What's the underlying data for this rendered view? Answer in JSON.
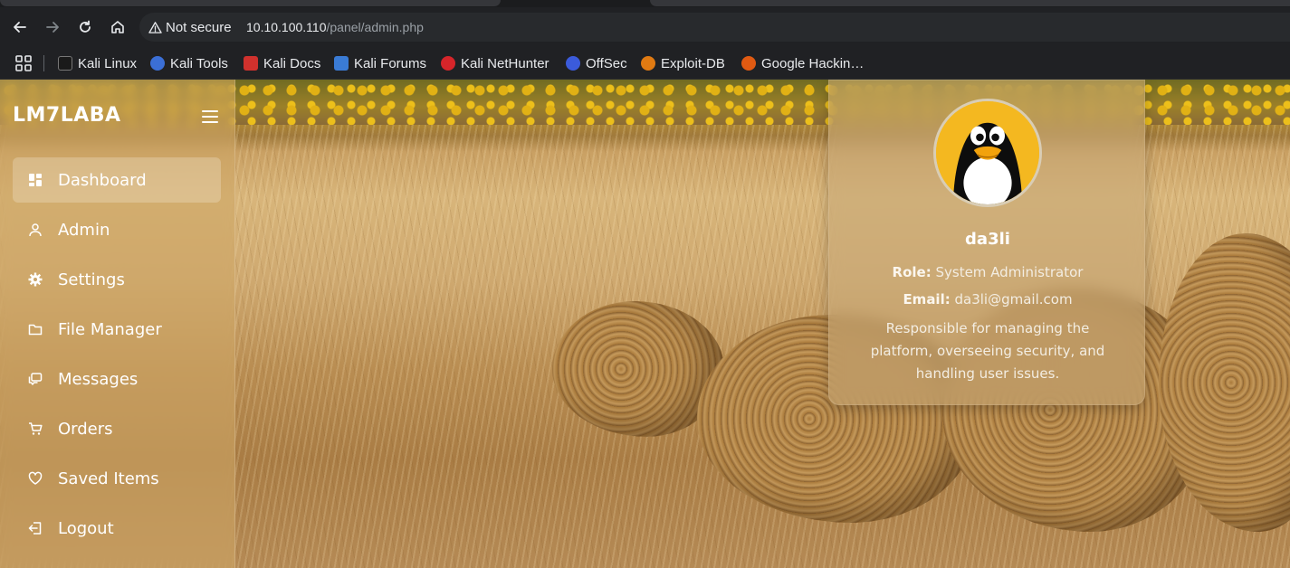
{
  "browser": {
    "security_label": "Not secure",
    "url_host": "10.10.100.110",
    "url_path": "/panel/admin.php",
    "bookmarks": [
      {
        "label": "Kali Linux",
        "icon": "kali-dragon-icon",
        "color": "#1a1a1a"
      },
      {
        "label": "Kali Tools",
        "icon": "kali-tools-icon",
        "color": "#3b6fd6"
      },
      {
        "label": "Kali Docs",
        "icon": "kali-docs-icon",
        "color": "#d0312d"
      },
      {
        "label": "Kali Forums",
        "icon": "kali-forums-icon",
        "color": "#3a7bd5"
      },
      {
        "label": "Kali NetHunter",
        "icon": "nethunter-icon",
        "color": "#d6252a"
      },
      {
        "label": "OffSec",
        "icon": "offsec-icon",
        "color": "#3b5bdb"
      },
      {
        "label": "Exploit-DB",
        "icon": "exploit-db-icon",
        "color": "#e07a12"
      },
      {
        "label": "Google Hackin…",
        "icon": "ghdb-icon",
        "color": "#e05a12"
      }
    ]
  },
  "sidebar": {
    "brand": "LM7LABA",
    "items": [
      {
        "label": "Dashboard",
        "icon": "dashboard-icon",
        "active": true
      },
      {
        "label": "Admin",
        "icon": "user-icon",
        "active": false
      },
      {
        "label": "Settings",
        "icon": "gear-icon",
        "active": false
      },
      {
        "label": "File Manager",
        "icon": "folder-icon",
        "active": false
      },
      {
        "label": "Messages",
        "icon": "messages-icon",
        "active": false
      },
      {
        "label": "Orders",
        "icon": "cart-icon",
        "active": false
      },
      {
        "label": "Saved Items",
        "icon": "heart-icon",
        "active": false
      },
      {
        "label": "Logout",
        "icon": "logout-icon",
        "active": false
      }
    ]
  },
  "profile": {
    "name": "da3li",
    "role_label": "Role:",
    "role": "System Administrator",
    "email_label": "Email:",
    "email": "da3li@gmail.com",
    "description": "Responsible for managing the platform, overseeing security, and handling user issues."
  }
}
